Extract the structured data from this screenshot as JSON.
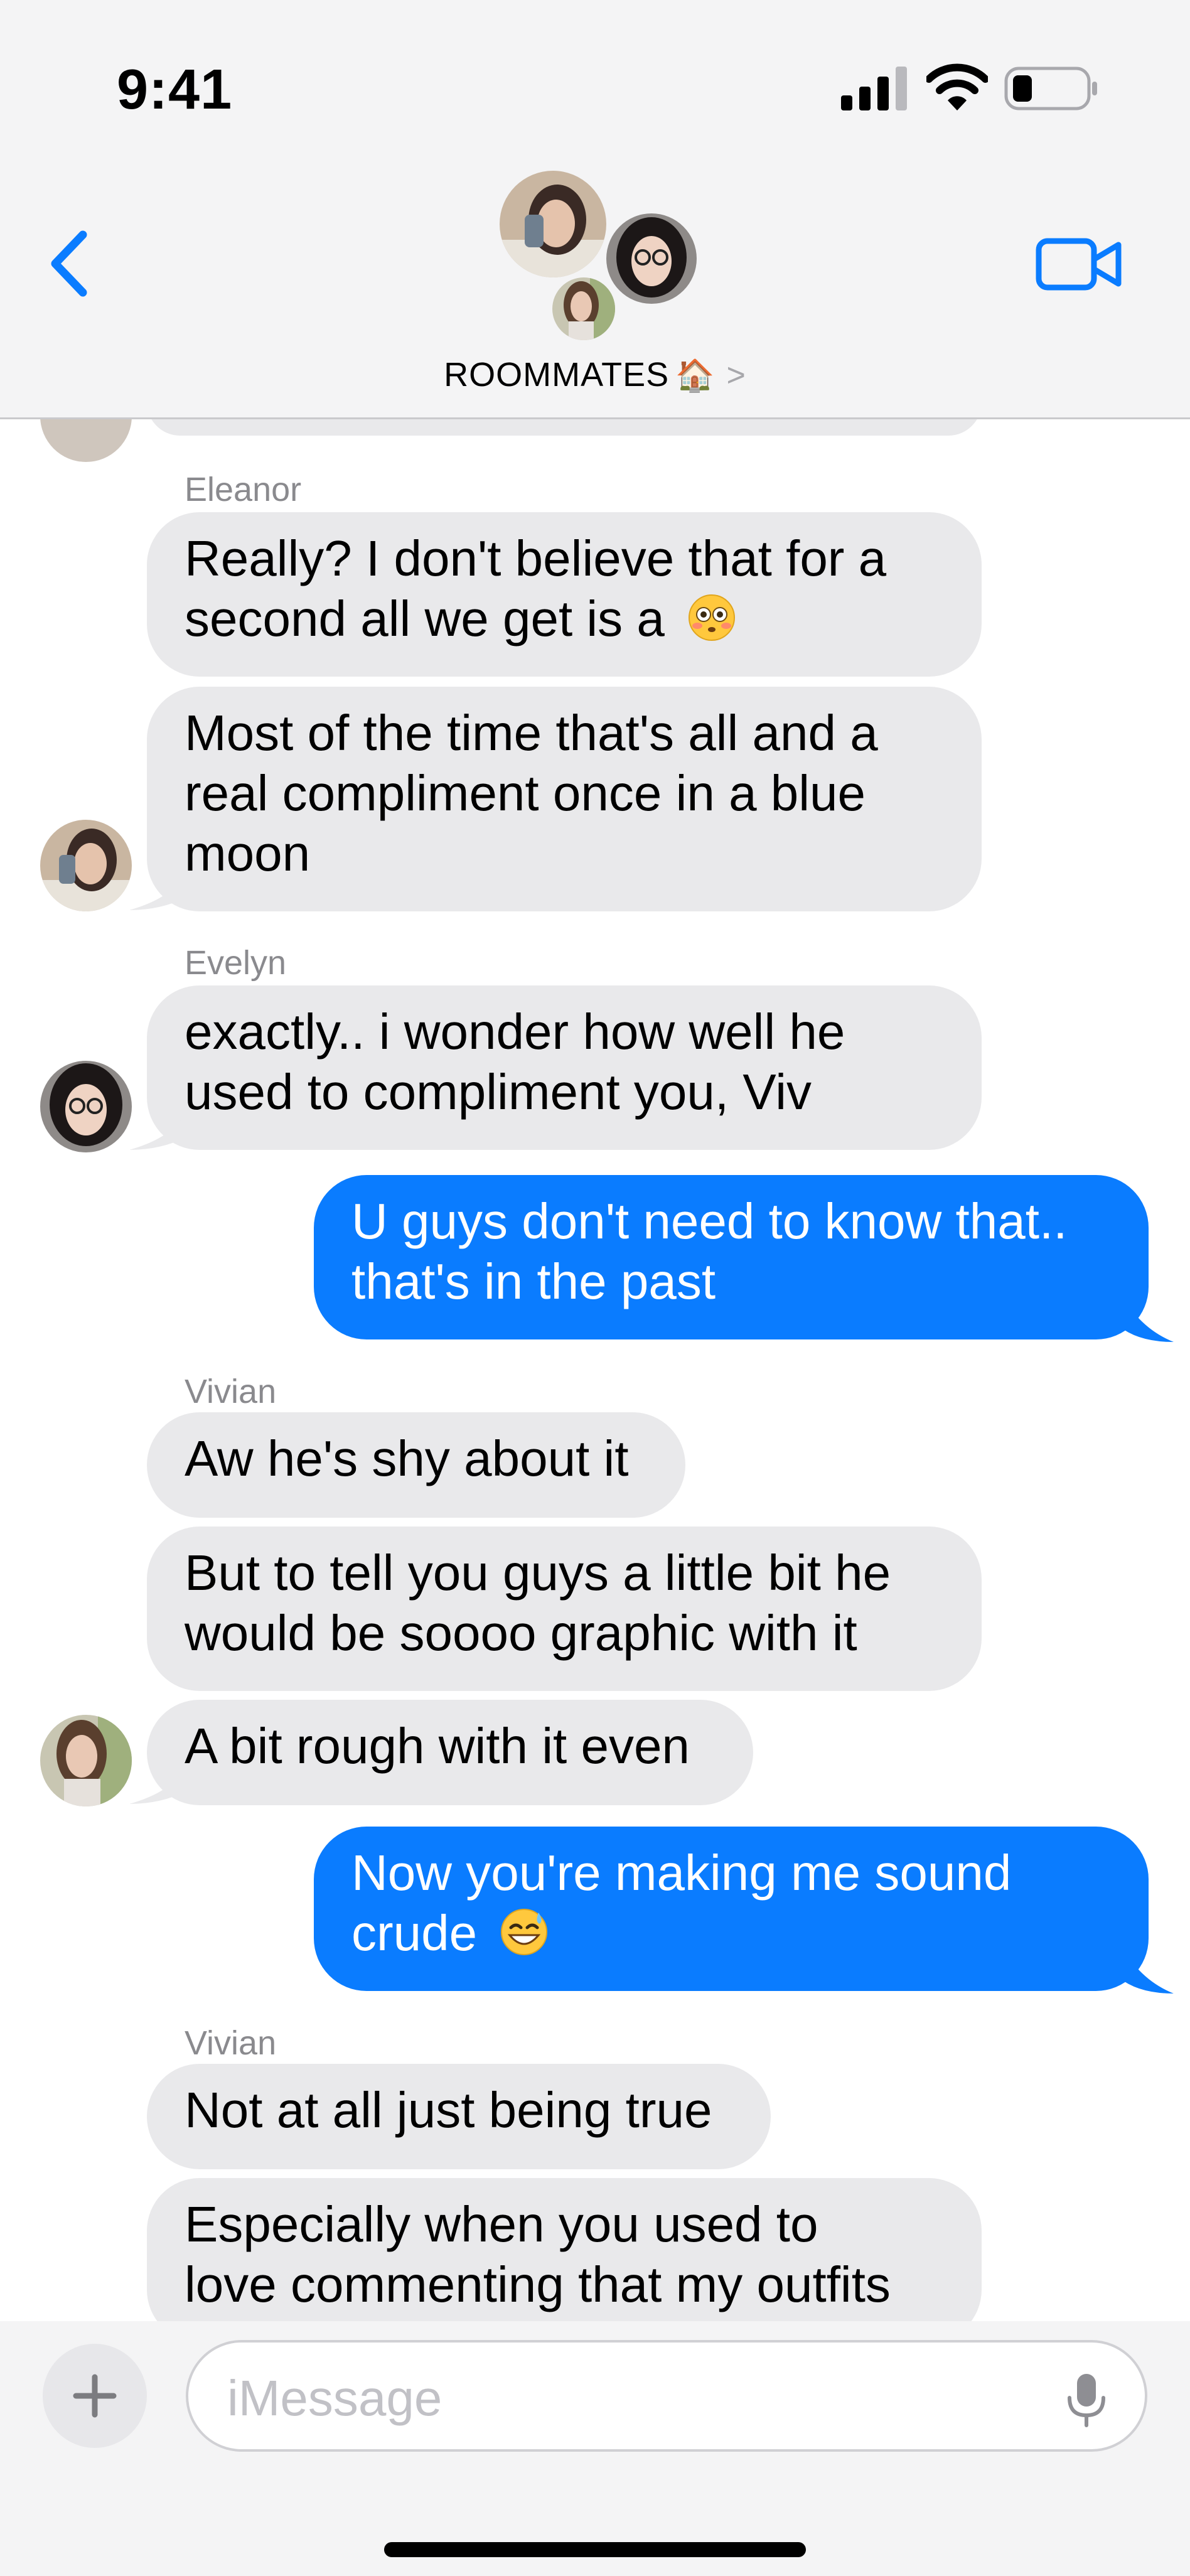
{
  "status_bar": {
    "time": "9:41"
  },
  "header": {
    "group_name": "ROOMMATES",
    "group_emoji": "🏠",
    "chevron": ">"
  },
  "messages": [
    {
      "sender": "Eleanor",
      "direction": "incoming",
      "text": "Really? I don't believe that for a\nsecond all we get is a",
      "emoji": "flushed-face"
    },
    {
      "direction": "incoming",
      "text": "Most of the time that's all and a\nreal compliment once in a blue\nmoon"
    },
    {
      "sender": "Evelyn",
      "direction": "incoming",
      "text": "exactly.. i wonder how well he\nused to compliment you, Viv"
    },
    {
      "direction": "outgoing",
      "text": "U guys don't need to know that..\nthat's in the past"
    },
    {
      "sender": "Vivian",
      "direction": "incoming",
      "text": "Aw he's shy about it"
    },
    {
      "direction": "incoming",
      "text": "But to tell you guys a little bit he\nwould be soooo graphic with it"
    },
    {
      "direction": "incoming",
      "text": "A bit rough with it even"
    },
    {
      "direction": "outgoing",
      "text": "Now you're making me sound\ncrude",
      "emoji": "grinning-sweat-face"
    },
    {
      "sender": "Vivian",
      "direction": "incoming",
      "text": "Not at all just being true"
    },
    {
      "direction": "incoming",
      "text": "Especially when you used to\nlove commenting that my outfits"
    }
  ],
  "composer": {
    "placeholder": "iMessage"
  },
  "colors": {
    "outgoing_bubble": "#0a7cff",
    "incoming_bubble": "#e9e9eb",
    "accent": "#0a7cff"
  }
}
